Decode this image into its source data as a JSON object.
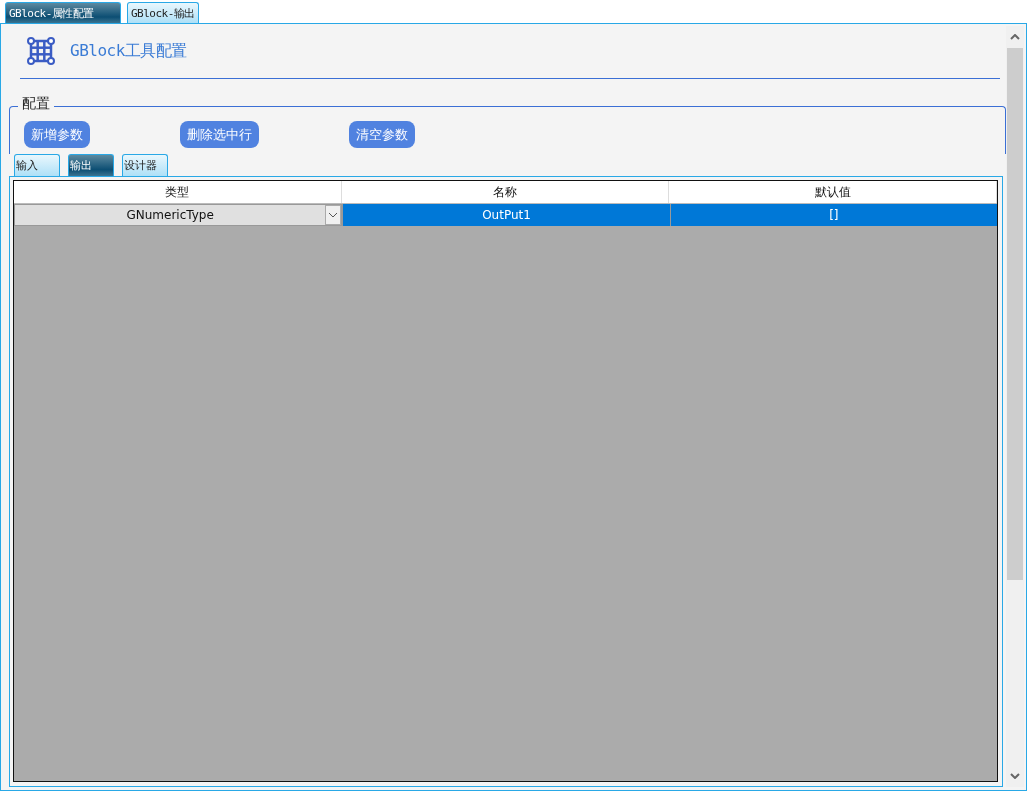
{
  "top_tabs": [
    {
      "label": "GBlock-属性配置",
      "selected": true
    },
    {
      "label": "GBlock-输出",
      "selected": false
    }
  ],
  "header": {
    "title": "GBlock工具配置"
  },
  "group": {
    "label": "配置"
  },
  "buttons": [
    "新增参数",
    "删除选中行",
    "清空参数"
  ],
  "inner_tabs": [
    {
      "label": "输入",
      "selected": false
    },
    {
      "label": "输出",
      "selected": true
    },
    {
      "label": "设计器",
      "selected": false
    }
  ],
  "table": {
    "columns": [
      "类型",
      "名称",
      "默认值"
    ],
    "rows": [
      {
        "selected": true,
        "cells": [
          {
            "kind": "dropdown",
            "value": "GNumericType"
          },
          {
            "kind": "text",
            "value": "OutPut1"
          },
          {
            "kind": "text",
            "value": "[]"
          }
        ]
      }
    ]
  }
}
